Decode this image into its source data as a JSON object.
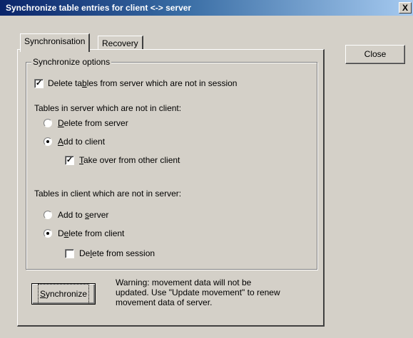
{
  "window": {
    "title": "Synchronize table entries for client <-> server",
    "close_glyph": "X"
  },
  "tabs": [
    {
      "label": "Synchronisation",
      "active": true
    },
    {
      "label": "Recovery",
      "active": false
    }
  ],
  "close_button": {
    "label": "Close"
  },
  "sync_options": {
    "group_label": "Synchronize options",
    "delete_tables": {
      "pre": "Delete ta",
      "accel": "b",
      "post": "les from server which are not in session",
      "checked": true
    },
    "server_section_label": "Tables in server which are not in client:",
    "delete_from_server": {
      "pre": "",
      "accel": "D",
      "post": "elete from server",
      "selected": false
    },
    "add_to_client": {
      "pre": "",
      "accel": "A",
      "post": "dd to client",
      "selected": true
    },
    "take_over": {
      "pre": "",
      "accel": "T",
      "post": "ake over from other client",
      "checked": true
    },
    "client_section_label": "Tables in client which are not in server:",
    "add_to_server": {
      "pre": "Add to ",
      "accel": "s",
      "post": "erver",
      "selected": false
    },
    "delete_from_client": {
      "pre": "D",
      "accel": "e",
      "post": "lete from client",
      "selected": true
    },
    "delete_from_session": {
      "pre": "De",
      "accel": "l",
      "post": "ete from session",
      "checked": false
    }
  },
  "synchronize_button": {
    "pre": "",
    "accel": "S",
    "post": "ynchronize"
  },
  "warning_text": "Warning: movement data will not be updated. Use \"Update movement\" to renew movement data of server."
}
